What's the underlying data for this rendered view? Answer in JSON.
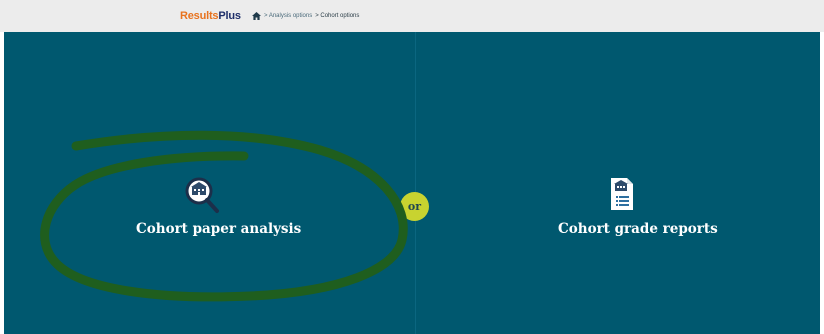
{
  "header": {
    "logo_results": "Results",
    "logo_plus": "Plus",
    "crumbs": [
      {
        "label": "> Analysis options"
      },
      {
        "label": "> Cohort options"
      }
    ]
  },
  "options": {
    "left": {
      "label": "Cohort paper analysis",
      "icon": "magnifier-school-icon"
    },
    "separator": "or",
    "right": {
      "label": "Cohort grade reports",
      "icon": "report-school-icon"
    }
  },
  "colors": {
    "background": "#00586f",
    "topbar": "#ececec",
    "or_badge": "#c8d330",
    "annotation": "#1f5e1e"
  }
}
